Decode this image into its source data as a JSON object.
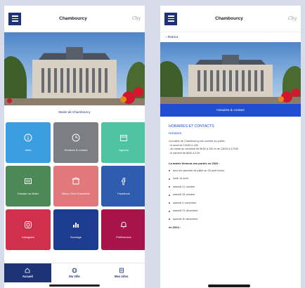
{
  "left_screen": {
    "app_title": "Chambourcy",
    "logo_text": "Cby",
    "photo_caption": "Mairie de Chambourcy",
    "tiles": [
      {
        "label": "Infos",
        "icon": "info-icon",
        "color": "#3a9ee0"
      },
      {
        "label": "Horaires & contact",
        "icon": "clock-icon",
        "color": "#7d7e83"
      },
      {
        "label": "Agenda",
        "icon": "calendar-icon",
        "color": "#4ec4a2"
      },
      {
        "label": "Dossier du Maire",
        "icon": "newspaper-icon",
        "color": "#4d8858"
      },
      {
        "label": "Mieux Vivre Ensemble",
        "icon": "building-icon",
        "color": "#e1787c"
      },
      {
        "label": "Facebook",
        "icon": "facebook-icon",
        "color": "#2e5cae"
      },
      {
        "label": "Instagram",
        "icon": "instagram-icon",
        "color": "#d1304c"
      },
      {
        "label": "Sondage",
        "icon": "bar-chart-icon",
        "color": "#1e3c8f"
      },
      {
        "label": "Préférences",
        "icon": "bell-icon",
        "color": "#a8144a"
      }
    ],
    "tabs": [
      {
        "label": "Accueil",
        "icon": "home-icon"
      },
      {
        "label": "Ma Ville",
        "icon": "globe-icon"
      },
      {
        "label": "Mes infos",
        "icon": "document-icon"
      }
    ]
  },
  "right_screen": {
    "app_title": "Chambourcy",
    "logo_text": "Cby",
    "back_label": "‹ Retour",
    "banner_label": "Horaires & contact",
    "section_title": "HORAIRES ET CONTACTS",
    "subsection_title": "Horaires",
    "hours_lines": [
      "La mairie de Chambourcy est ouverte au public :",
      "- le lundi de 13h30 à 18h",
      "- du mardi au vendredi de 8h30 à 12h et de 13h30 à 17h30",
      "- le samedi de 8h30 à 12h"
    ],
    "closures_title": "La mairie fermera ses portes en 2023 :",
    "closures": [
      "tous les samedis de juillet au 26 août inclus",
      "lundi 14 août",
      "samedi 21 octobre",
      "samedi 28 octobre",
      "samedi 4 novembre",
      "samedi 23 décembre",
      "samedi 30 décembre"
    ],
    "footer_title": "en 2024 :"
  },
  "colors": {
    "brand_navy": "#1d3277",
    "banner_blue": "#1f4fd0",
    "background": "#d6dcea"
  }
}
